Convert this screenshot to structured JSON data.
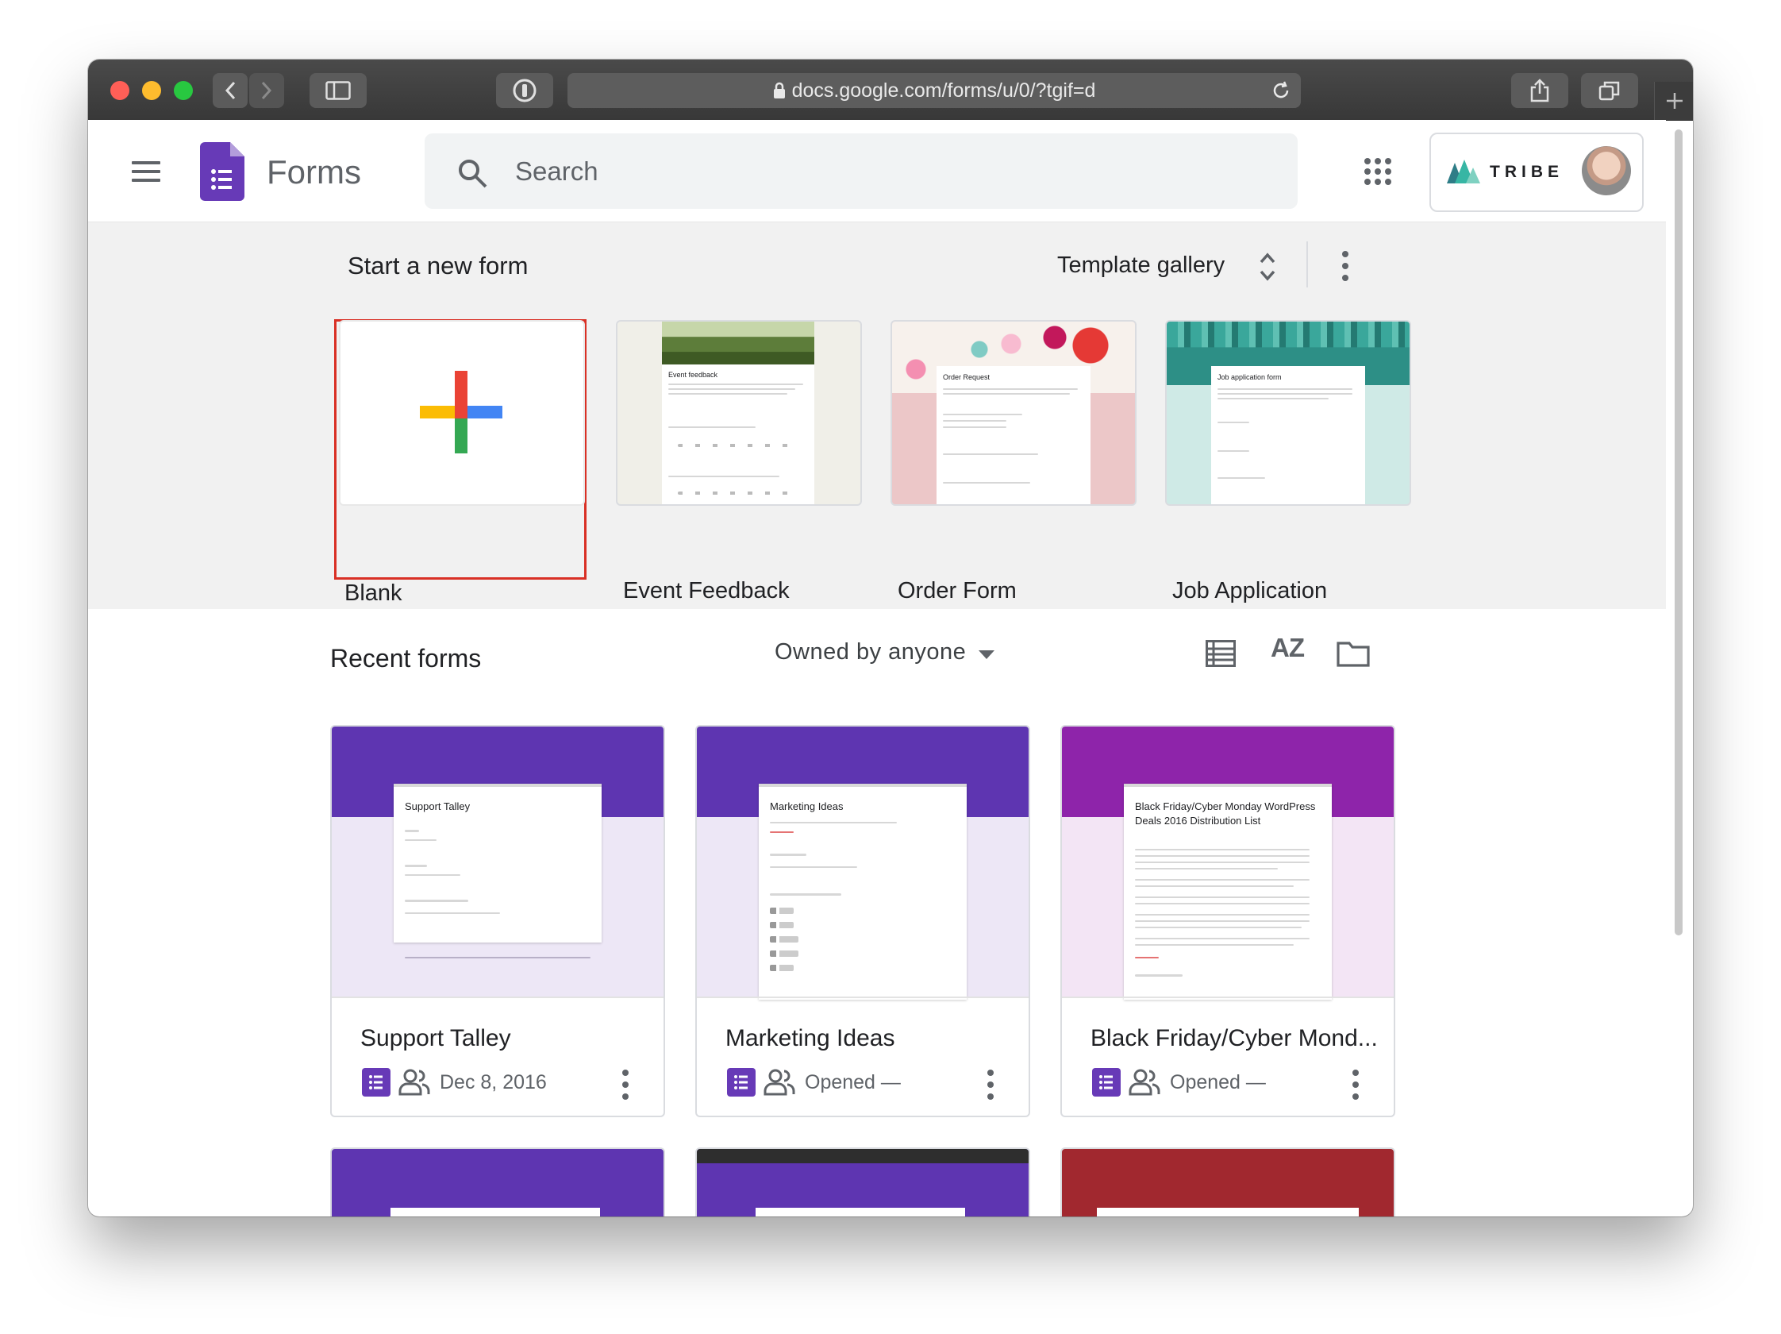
{
  "browser": {
    "url": "docs.google.com/forms/u/0/?tgif=d"
  },
  "app": {
    "title": "Forms",
    "search_placeholder": "Search",
    "account_brand": "TRIBE"
  },
  "start": {
    "title": "Start a new form",
    "template_gallery_label": "Template gallery",
    "templates": [
      {
        "label": "Blank",
        "selected": true
      },
      {
        "label": "Event Feedback",
        "thumb_title": "Event feedback"
      },
      {
        "label": "Order Form",
        "thumb_title": "Order Request"
      },
      {
        "label": "Job Application",
        "thumb_title": "Job application form"
      }
    ]
  },
  "recent": {
    "title": "Recent forms",
    "owner_filter": "Owned by anyone",
    "forms": [
      {
        "title": "Support Talley",
        "thumb_title": "Support Talley",
        "meta": "Dec 8, 2016",
        "header_color": "#5e35b1",
        "body_color": "#ede7f6"
      },
      {
        "title": "Marketing Ideas",
        "thumb_title": "Marketing Ideas",
        "meta": "Opened —",
        "header_color": "#5e35b1",
        "body_color": "#ede7f6"
      },
      {
        "title": "Black Friday/Cyber Mond...",
        "thumb_title": "Black Friday/Cyber Monday WordPress Deals 2016 Distribution List",
        "meta": "Opened —",
        "header_color": "#8e24aa",
        "body_color": "#f3e5f5"
      }
    ],
    "peek_colors": [
      "#5e35b1",
      "#5e35b1",
      "#a1282f"
    ]
  },
  "colors": {
    "forms_purple": "#673ab7",
    "highlight_red": "#d93025"
  },
  "icons": [
    "hamburger-icon",
    "forms-logo-icon",
    "search-icon",
    "apps-grid-icon",
    "more-vert-icon",
    "list-view-icon",
    "sort-az-icon",
    "folder-icon",
    "people-icon"
  ]
}
